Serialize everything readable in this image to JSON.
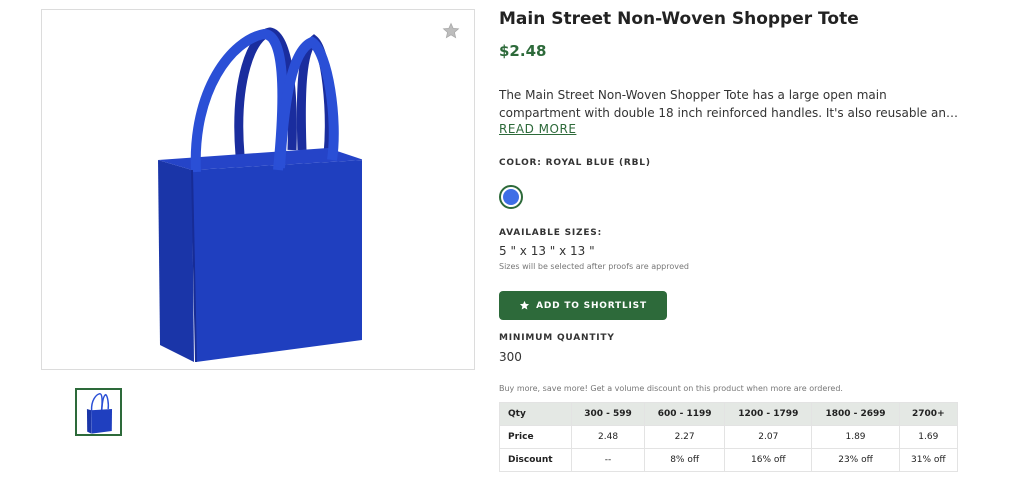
{
  "product": {
    "title": "Main Street Non-Woven Shopper Tote",
    "price": "$2.48",
    "description": "The Main Street Non-Woven Shopper Tote has a large open main compartment with double 18 inch reinforced handles. It's also reusable and a great alternative to plastic bags.",
    "read_more": "READ MORE"
  },
  "color": {
    "label": "COLOR: ROYAL BLUE (RBL)",
    "swatch_hex": "#3e6ee6"
  },
  "sizes": {
    "label": "AVAILABLE SIZES:",
    "value": "5 \" x 13 \" x 13 \"",
    "note": "Sizes will be selected after proofs are approved"
  },
  "shortlist": {
    "label": "ADD TO SHORTLIST",
    "icon": "star-icon"
  },
  "minimum": {
    "label": "MINIMUM QUANTITY",
    "value": "300"
  },
  "volume": {
    "note": "Buy more, save more! Get a volume discount on this product when more are ordered.",
    "headers": [
      "Qty",
      "300 - 599",
      "600 - 1199",
      "1200 - 1799",
      "1800 - 2699",
      "2700+"
    ],
    "rows": [
      [
        "Price",
        "2.48",
        "2.27",
        "2.07",
        "1.89",
        "1.69"
      ],
      [
        "Discount",
        "--",
        "8% off",
        "16% off",
        "23% off",
        "31% off"
      ]
    ]
  },
  "colors": {
    "accent": "#2d6a3a",
    "bag_blue": "#1f3fbf"
  },
  "icons": {
    "favorite": "star-icon"
  }
}
